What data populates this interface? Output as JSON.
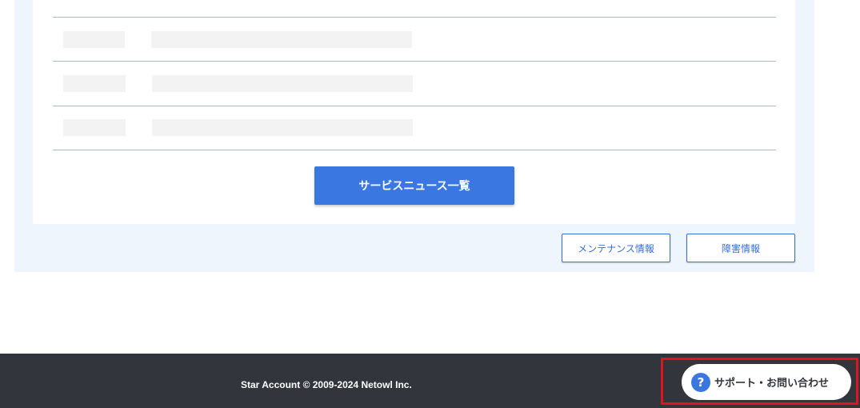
{
  "news": {
    "list_button_label": "サービスニュース一覧"
  },
  "links": {
    "maintenance_label": "メンテナンス情報",
    "incident_label": "障害情報"
  },
  "footer": {
    "copyright": "Star Account © 2009-2024 Netowl Inc.",
    "support_label": "サポート・お問い合わせ",
    "support_icon": "question-circle-icon"
  },
  "colors": {
    "accent": "#3b77e0",
    "footer_bg": "#32353c",
    "panel_bg": "#eef5fc",
    "highlight": "#e0141f"
  }
}
